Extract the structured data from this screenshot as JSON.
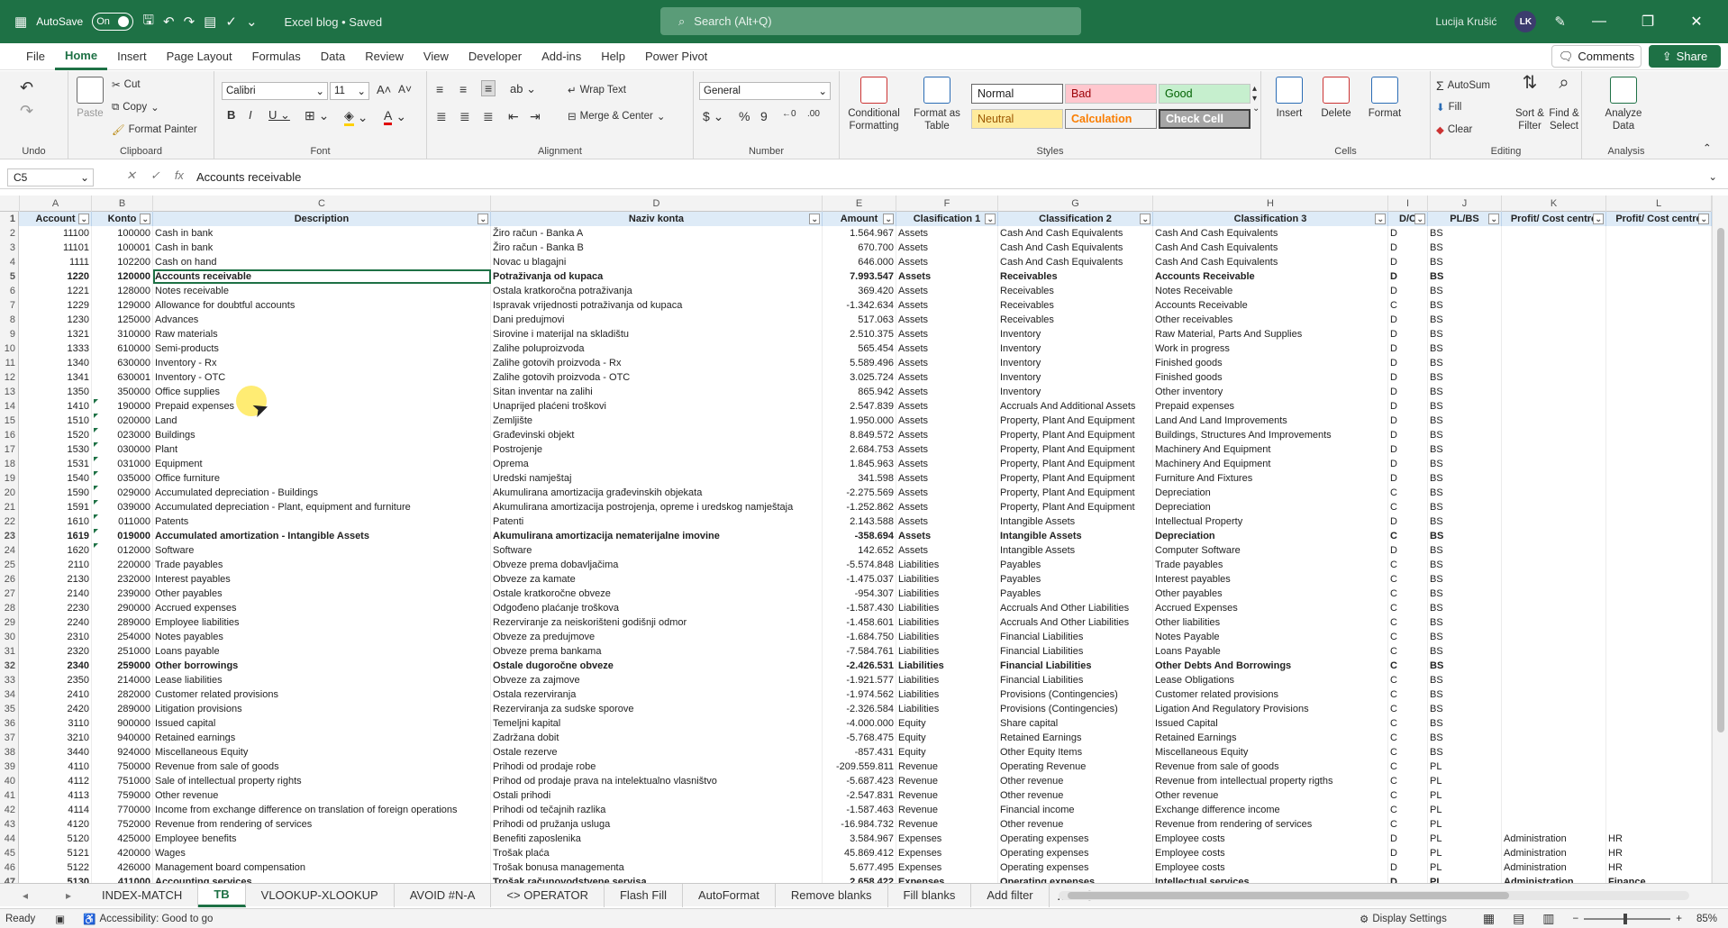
{
  "title": {
    "autosave": "AutoSave",
    "toggle": "On",
    "file": "Excel blog • Saved",
    "search": "Search (Alt+Q)",
    "user": "Lucija Krušić",
    "initials": "LK"
  },
  "menu": [
    "File",
    "Home",
    "Insert",
    "Page Layout",
    "Formulas",
    "Data",
    "Review",
    "View",
    "Developer",
    "Add-ins",
    "Help",
    "Power Pivot"
  ],
  "comments": "Comments",
  "share": "Share",
  "ribbon": {
    "undo": "Undo",
    "clipboard": "Clipboard",
    "paste": "Paste",
    "cut": "Cut",
    "copy": "Copy",
    "format_painter": "Format Painter",
    "font_group": "Font",
    "font": "Calibri",
    "size": "11",
    "alignment": "Alignment",
    "wrap": "Wrap Text",
    "merge": "Merge & Center",
    "number_group": "Number",
    "number_format": "General",
    "cond_fmt": "Conditional Formatting",
    "format_table": "Format as Table",
    "styles": "Styles",
    "s_normal": "Normal",
    "s_bad": "Bad",
    "s_good": "Good",
    "s_neutral": "Neutral",
    "s_calc": "Calculation",
    "s_check": "Check Cell",
    "cells": "Cells",
    "insert": "Insert",
    "delete": "Delete",
    "format": "Format",
    "editing": "Editing",
    "autosum": "AutoSum",
    "fill": "Fill",
    "clear": "Clear",
    "sort": "Sort & Filter",
    "find": "Find & Select",
    "analysis": "Analysis",
    "analyze": "Analyze Data"
  },
  "formula_bar": {
    "cell": "C5",
    "value": "Accounts receivable"
  },
  "columns": [
    "A",
    "B",
    "C",
    "D",
    "E",
    "F",
    "G",
    "H",
    "I",
    "J",
    "K",
    "L"
  ],
  "header_row": [
    "Account",
    "Konto",
    "Description",
    "Naziv konta",
    "Amount",
    "Clasification 1",
    "Classification 2",
    "Classification 3",
    "D/C",
    "PL/BS",
    "Profit/ Cost centre",
    "Profit/ Cost centre"
  ],
  "rows": [
    [
      "11100",
      "100000",
      "Cash in bank",
      "Žiro račun - Banka A",
      "1.564.967",
      "Assets",
      "Cash And Cash Equivalents",
      "Cash And Cash Equivalents",
      "D",
      "BS",
      "",
      ""
    ],
    [
      "11101",
      "100001",
      "Cash in bank",
      "Žiro račun - Banka B",
      "670.700",
      "Assets",
      "Cash And Cash Equivalents",
      "Cash And Cash Equivalents",
      "D",
      "BS",
      "",
      ""
    ],
    [
      "1111",
      "102200",
      "Cash on hand",
      "Novac u blagajni",
      "646.000",
      "Assets",
      "Cash And Cash Equivalents",
      "Cash And Cash Equivalents",
      "D",
      "BS",
      "",
      ""
    ],
    [
      "1220",
      "120000",
      "Accounts receivable",
      "Potraživanja od kupaca",
      "7.993.547",
      "Assets",
      "Receivables",
      "Accounts Receivable",
      "D",
      "BS",
      "",
      ""
    ],
    [
      "1221",
      "128000",
      "Notes receivable",
      "Ostala kratkoročna potraživanja",
      "369.420",
      "Assets",
      "Receivables",
      "Notes Receivable",
      "D",
      "BS",
      "",
      ""
    ],
    [
      "1229",
      "129000",
      "Allowance for doubtful accounts",
      "Ispravak vrijednosti potraživanja od kupaca",
      "-1.342.634",
      "Assets",
      "Receivables",
      "Accounts Receivable",
      "C",
      "BS",
      "",
      ""
    ],
    [
      "1230",
      "125000",
      "Advances",
      "Dani predujmovi",
      "517.063",
      "Assets",
      "Receivables",
      "Other receivables",
      "D",
      "BS",
      "",
      ""
    ],
    [
      "1321",
      "310000",
      "Raw materials",
      "Sirovine i materijal na skladištu",
      "2.510.375",
      "Assets",
      "Inventory",
      "Raw Material, Parts And Supplies",
      "D",
      "BS",
      "",
      ""
    ],
    [
      "1333",
      "610000",
      "Semi-products",
      "Zalihe poluproizvoda",
      "565.454",
      "Assets",
      "Inventory",
      "Work in progress",
      "D",
      "BS",
      "",
      ""
    ],
    [
      "1340",
      "630000",
      "Inventory - Rx",
      "Zalihe gotovih proizvoda - Rx",
      "5.589.496",
      "Assets",
      "Inventory",
      "Finished goods",
      "D",
      "BS",
      "",
      ""
    ],
    [
      "1341",
      "630001",
      "Inventory - OTC",
      "Zalihe gotovih proizvoda - OTC",
      "3.025.724",
      "Assets",
      "Inventory",
      "Finished goods",
      "D",
      "BS",
      "",
      ""
    ],
    [
      "1350",
      "350000",
      "Office supplies",
      "Sitan inventar na zalihi",
      "865.942",
      "Assets",
      "Inventory",
      "Other inventory",
      "D",
      "BS",
      "",
      ""
    ],
    [
      "1410",
      "190000",
      "Prepaid expenses",
      "Unaprijed plaćeni troškovi",
      "2.547.839",
      "Assets",
      "Accruals And Additional Assets",
      "Prepaid expenses",
      "D",
      "BS",
      "",
      ""
    ],
    [
      "1510",
      "020000",
      "Land",
      "Zemljište",
      "1.950.000",
      "Assets",
      "Property, Plant And Equipment",
      "Land And Land Improvements",
      "D",
      "BS",
      "",
      ""
    ],
    [
      "1520",
      "023000",
      "Buildings",
      "Građevinski objekt",
      "8.849.572",
      "Assets",
      "Property, Plant And Equipment",
      "Buildings, Structures And Improvements",
      "D",
      "BS",
      "",
      ""
    ],
    [
      "1530",
      "030000",
      "Plant",
      "Postrojenje",
      "2.684.753",
      "Assets",
      "Property, Plant And Equipment",
      "Machinery And Equipment",
      "D",
      "BS",
      "",
      ""
    ],
    [
      "1531",
      "031000",
      "Equipment",
      "Oprema",
      "1.845.963",
      "Assets",
      "Property, Plant And Equipment",
      "Machinery And Equipment",
      "D",
      "BS",
      "",
      ""
    ],
    [
      "1540",
      "035000",
      "Office furniture",
      "Uredski namještaj",
      "341.598",
      "Assets",
      "Property, Plant And Equipment",
      "Furniture And Fixtures",
      "D",
      "BS",
      "",
      ""
    ],
    [
      "1590",
      "029000",
      "Accumulated depreciation - Buildings",
      "Akumulirana amortizacija građevinskih objekata",
      "-2.275.569",
      "Assets",
      "Property, Plant And Equipment",
      "Depreciation",
      "C",
      "BS",
      "",
      ""
    ],
    [
      "1591",
      "039000",
      "Accumulated depreciation - Plant, equipment and furniture",
      "Akumulirana amortizacija postrojenja, opreme i uredskog namještaja",
      "-1.252.862",
      "Assets",
      "Property, Plant And Equipment",
      "Depreciation",
      "C",
      "BS",
      "",
      ""
    ],
    [
      "1610",
      "011000",
      "Patents",
      "Patenti",
      "2.143.588",
      "Assets",
      "Intangible Assets",
      "Intellectual Property",
      "D",
      "BS",
      "",
      ""
    ],
    [
      "1619",
      "019000",
      "Accumulated amortization - Intangible Assets",
      "Akumulirana amortizacija nematerijalne imovine",
      "-358.694",
      "Assets",
      "Intangible Assets",
      "Depreciation",
      "C",
      "BS",
      "",
      ""
    ],
    [
      "1620",
      "012000",
      "Software",
      "Software",
      "142.652",
      "Assets",
      "Intangible Assets",
      "Computer Software",
      "D",
      "BS",
      "",
      ""
    ],
    [
      "2110",
      "220000",
      "Trade payables",
      "Obveze prema dobavljačima",
      "-5.574.848",
      "Liabilities",
      "Payables",
      "Trade payables",
      "C",
      "BS",
      "",
      ""
    ],
    [
      "2130",
      "232000",
      "Interest payables",
      "Obveze za kamate",
      "-1.475.037",
      "Liabilities",
      "Payables",
      "Interest payables",
      "C",
      "BS",
      "",
      ""
    ],
    [
      "2140",
      "239000",
      "Other payables",
      "Ostale kratkoročne obveze",
      "-954.307",
      "Liabilities",
      "Payables",
      "Other payables",
      "C",
      "BS",
      "",
      ""
    ],
    [
      "2230",
      "290000",
      "Accrued expenses",
      "Odgođeno plaćanje troškova",
      "-1.587.430",
      "Liabilities",
      "Accruals And Other Liabilities",
      "Accrued Expenses",
      "C",
      "BS",
      "",
      ""
    ],
    [
      "2240",
      "289000",
      "Employee liabilities",
      "Rezerviranje za neiskorišteni godišnji odmor",
      "-1.458.601",
      "Liabilities",
      "Accruals And Other Liabilities",
      "Other liabilities",
      "C",
      "BS",
      "",
      ""
    ],
    [
      "2310",
      "254000",
      "Notes payables",
      "Obveze za predujmove",
      "-1.684.750",
      "Liabilities",
      "Financial Liabilities",
      "Notes Payable",
      "C",
      "BS",
      "",
      ""
    ],
    [
      "2320",
      "251000",
      "Loans payable",
      "Obveze prema bankama",
      "-7.584.761",
      "Liabilities",
      "Financial Liabilities",
      "Loans Payable",
      "C",
      "BS",
      "",
      ""
    ],
    [
      "2340",
      "259000",
      "Other borrowings",
      "Ostale dugoročne obveze",
      "-2.426.531",
      "Liabilities",
      "Financial Liabilities",
      "Other Debts And Borrowings",
      "C",
      "BS",
      "",
      ""
    ],
    [
      "2350",
      "214000",
      "Lease liabilities",
      "Obveze za zajmove",
      "-1.921.577",
      "Liabilities",
      "Financial Liabilities",
      "Lease Obligations",
      "C",
      "BS",
      "",
      ""
    ],
    [
      "2410",
      "282000",
      "Customer related provisions",
      "Ostala rezerviranja",
      "-1.974.562",
      "Liabilities",
      "Provisions (Contingencies)",
      "Customer related provisions",
      "C",
      "BS",
      "",
      ""
    ],
    [
      "2420",
      "289000",
      "Litigation provisions",
      "Rezerviranja za sudske sporove",
      "-2.326.584",
      "Liabilities",
      "Provisions (Contingencies)",
      "Ligation And Regulatory Provisions",
      "C",
      "BS",
      "",
      ""
    ],
    [
      "3110",
      "900000",
      "Issued capital",
      "Temeljni kapital",
      "-4.000.000",
      "Equity",
      "Share capital",
      "Issued Capital",
      "C",
      "BS",
      "",
      ""
    ],
    [
      "3210",
      "940000",
      "Retained earnings",
      "Zadržana dobit",
      "-5.768.475",
      "Equity",
      "Retained Earnings",
      "Retained Earnings",
      "C",
      "BS",
      "",
      ""
    ],
    [
      "3440",
      "924000",
      "Miscellaneous Equity",
      "Ostale rezerve",
      "-857.431",
      "Equity",
      "Other Equity Items",
      "Miscellaneous Equity",
      "C",
      "BS",
      "",
      ""
    ],
    [
      "4110",
      "750000",
      "Revenue from sale of goods",
      "Prihodi od prodaje robe",
      "-209.559.811",
      "Revenue",
      "Operating Revenue",
      "Revenue from sale of goods",
      "C",
      "PL",
      "",
      ""
    ],
    [
      "4112",
      "751000",
      "Sale of intellectual property rights",
      "Prihod od prodaje prava na intelektualno vlasništvo",
      "-5.687.423",
      "Revenue",
      "Other revenue",
      "Revenue from intellectual property rigths",
      "C",
      "PL",
      "",
      ""
    ],
    [
      "4113",
      "759000",
      "Other revenue",
      "Ostali prihodi",
      "-2.547.831",
      "Revenue",
      "Other revenue",
      "Other revenue",
      "C",
      "PL",
      "",
      ""
    ],
    [
      "4114",
      "770000",
      "Income from exchange difference on translation of foreign operations",
      "Prihodi od tečajnih razlika",
      "-1.587.463",
      "Revenue",
      "Financial income",
      "Exchange difference income",
      "C",
      "PL",
      "",
      ""
    ],
    [
      "4120",
      "752000",
      "Revenue from rendering of services",
      "Prihodi od pružanja usluga",
      "-16.984.732",
      "Revenue",
      "Other revenue",
      "Revenue from rendering of services",
      "C",
      "PL",
      "",
      ""
    ],
    [
      "5120",
      "425000",
      "Employee benefits",
      "Benefiti zaposlenika",
      "3.584.967",
      "Expenses",
      "Operating expenses",
      "Employee costs",
      "D",
      "PL",
      "Administration",
      "HR"
    ],
    [
      "5121",
      "420000",
      "Wages",
      "Trošak plaća",
      "45.869.412",
      "Expenses",
      "Operating expenses",
      "Employee costs",
      "D",
      "PL",
      "Administration",
      "HR"
    ],
    [
      "5122",
      "426000",
      "Management board compensation",
      "Trošak bonusa managementa",
      "5.677.495",
      "Expenses",
      "Operating expenses",
      "Employee costs",
      "D",
      "PL",
      "Administration",
      "HR"
    ],
    [
      "5130",
      "411000",
      "Accounting services",
      "Trošak računovodstvene servisa",
      "2.658.422",
      "Expenses",
      "Operating expenses",
      "Intellectual services",
      "D",
      "PL",
      "Administration",
      "Finance"
    ]
  ],
  "bold_rows": [
    3,
    21,
    30,
    45
  ],
  "sheet_tabs": [
    "INDEX-MATCH",
    "TB",
    "VLOOKUP-XLOOKUP",
    "AVOID #N-A",
    "<> OPERATOR",
    "Flash Fill",
    "AutoFormat",
    "Remove blanks",
    "Fill blanks",
    "Add filter"
  ],
  "active_tab": "TB",
  "status": {
    "ready": "Ready",
    "accessibility": "Accessibility: Good to go",
    "display": "Display Settings",
    "zoom": "85%"
  }
}
